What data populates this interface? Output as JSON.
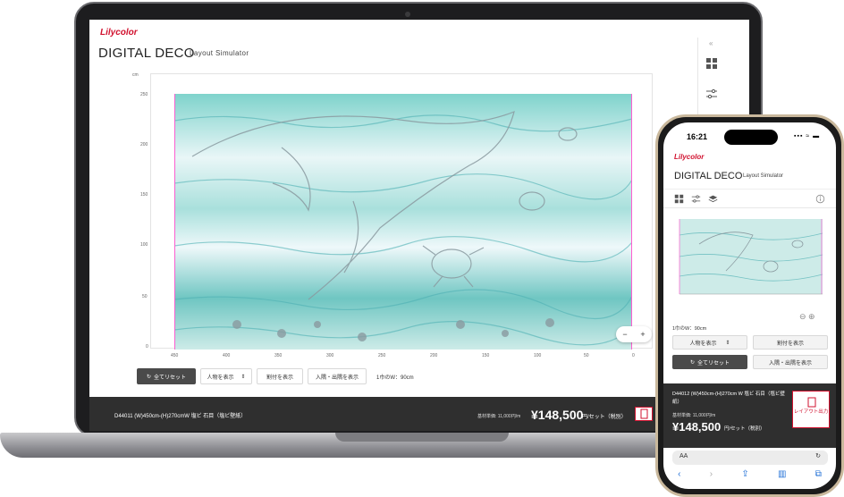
{
  "brand": {
    "logo_text": "Lilycolor",
    "accent": "#d1122f"
  },
  "laptop": {
    "title": "DIGITAL DECO",
    "subtitle": "Layout Simulator",
    "sidebar": {
      "collapse_icon": "double-chevron-left-icon",
      "icons": [
        "grid-layout-icon",
        "sliders-icon"
      ]
    },
    "axis": {
      "y_unit": "cm",
      "y_ticks": [
        "250",
        "200",
        "150",
        "100",
        "50",
        "0"
      ],
      "x_ticks": [
        "450",
        "400",
        "350",
        "300",
        "250",
        "200",
        "150",
        "100",
        "50",
        "0"
      ]
    },
    "zoom": {
      "minus": "−",
      "plus": "+"
    },
    "buttons": {
      "reset": "全てリセット",
      "show_person": "人物を表示",
      "show_split": "割付を表示",
      "show_openings": "入隅・出隅を表示"
    },
    "panel_width": "1巾のW：90cm",
    "footer": {
      "product": "D44011 (W)450cm-(H)270cmW 塩ビ 石目（塩ビ壁紙）",
      "unit_price": "基材単価: 11,000円/m",
      "price": "¥148,500",
      "price_unit": "円/セット（税別）"
    }
  },
  "phone": {
    "time": "16:21",
    "status": "▪▪▪ ≈ ▬",
    "title": "DIGITAL DECO",
    "subtitle": "Layout Simulator",
    "tool_icons": [
      "grid-layout-icon",
      "sliders-icon",
      "layers-icon",
      "info-icon"
    ],
    "panel_width": "1巾のW：90cm",
    "zoom_icons": "⊖ ⊕",
    "buttons": {
      "show_person": "人物を表示",
      "show_split": "割付を表示",
      "reset": "全てリセット",
      "show_openings": "入隅・出隅を表示"
    },
    "footer": {
      "product": "D44012 (W)450cm-(H)270cm W 塩ビ 石目（塩ビ壁紙）",
      "unit_price": "基材単価: 11,000円/m",
      "price": "¥148,500",
      "price_unit": "円/セット（税別）",
      "layout_button": "レイアウト出力"
    },
    "url_bar": {
      "text_size": "AA",
      "reload": "↻"
    },
    "nav": [
      "‹",
      "›",
      "⇪",
      "▥",
      "⧉"
    ]
  }
}
